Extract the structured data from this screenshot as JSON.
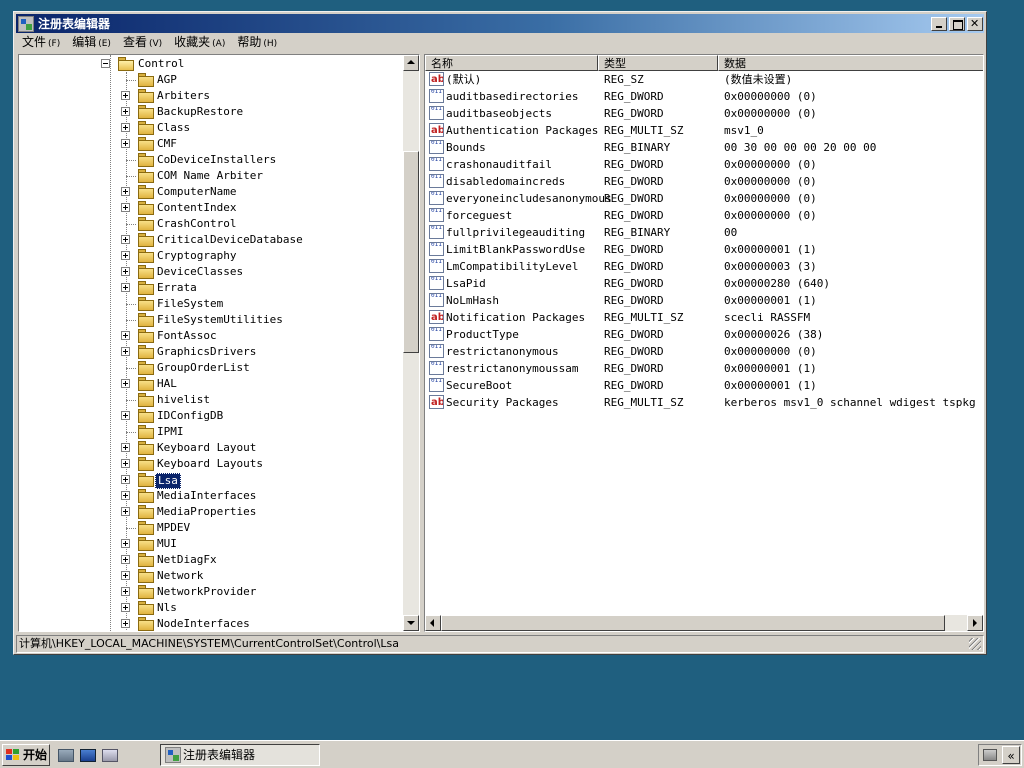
{
  "window": {
    "title": "注册表编辑器"
  },
  "menu": [
    {
      "label": "文件",
      "accel": "(F)"
    },
    {
      "label": "编辑",
      "accel": "(E)"
    },
    {
      "label": "查看",
      "accel": "(V)"
    },
    {
      "label": "收藏夹",
      "accel": "(A)"
    },
    {
      "label": "帮助",
      "accel": "(H)"
    }
  ],
  "tree": {
    "parent": "Control",
    "children": [
      {
        "label": "AGP",
        "expandable": false
      },
      {
        "label": "Arbiters",
        "expandable": true
      },
      {
        "label": "BackupRestore",
        "expandable": true
      },
      {
        "label": "Class",
        "expandable": true
      },
      {
        "label": "CMF",
        "expandable": true
      },
      {
        "label": "CoDeviceInstallers",
        "expandable": false
      },
      {
        "label": "COM Name Arbiter",
        "expandable": false
      },
      {
        "label": "ComputerName",
        "expandable": true
      },
      {
        "label": "ContentIndex",
        "expandable": true
      },
      {
        "label": "CrashControl",
        "expandable": false
      },
      {
        "label": "CriticalDeviceDatabase",
        "expandable": true
      },
      {
        "label": "Cryptography",
        "expandable": true
      },
      {
        "label": "DeviceClasses",
        "expandable": true
      },
      {
        "label": "Errata",
        "expandable": true
      },
      {
        "label": "FileSystem",
        "expandable": false
      },
      {
        "label": "FileSystemUtilities",
        "expandable": false
      },
      {
        "label": "FontAssoc",
        "expandable": true
      },
      {
        "label": "GraphicsDrivers",
        "expandable": true
      },
      {
        "label": "GroupOrderList",
        "expandable": false
      },
      {
        "label": "HAL",
        "expandable": true
      },
      {
        "label": "hivelist",
        "expandable": false
      },
      {
        "label": "IDConfigDB",
        "expandable": true
      },
      {
        "label": "IPMI",
        "expandable": false
      },
      {
        "label": "Keyboard Layout",
        "expandable": true
      },
      {
        "label": "Keyboard Layouts",
        "expandable": true
      },
      {
        "label": "Lsa",
        "expandable": true,
        "selected": true
      },
      {
        "label": "MediaInterfaces",
        "expandable": true
      },
      {
        "label": "MediaProperties",
        "expandable": true
      },
      {
        "label": "MPDEV",
        "expandable": false
      },
      {
        "label": "MUI",
        "expandable": true
      },
      {
        "label": "NetDiagFx",
        "expandable": true
      },
      {
        "label": "Network",
        "expandable": true
      },
      {
        "label": "NetworkProvider",
        "expandable": true
      },
      {
        "label": "Nls",
        "expandable": true
      },
      {
        "label": "NodeInterfaces",
        "expandable": true
      }
    ]
  },
  "columns": {
    "name": "名称",
    "type": "类型",
    "data": "数据"
  },
  "values": [
    {
      "icon": "string-value-icon",
      "kind": "str",
      "name": "(默认)",
      "type": "REG_SZ",
      "data": "(数值未设置)"
    },
    {
      "icon": "binary-value-icon",
      "kind": "bin",
      "name": "auditbasedirectories",
      "type": "REG_DWORD",
      "data": "0x00000000 (0)"
    },
    {
      "icon": "binary-value-icon",
      "kind": "bin",
      "name": "auditbaseobjects",
      "type": "REG_DWORD",
      "data": "0x00000000 (0)"
    },
    {
      "icon": "string-value-icon",
      "kind": "str",
      "name": "Authentication Packages",
      "type": "REG_MULTI_SZ",
      "data": "msv1_0"
    },
    {
      "icon": "binary-value-icon",
      "kind": "bin",
      "name": "Bounds",
      "type": "REG_BINARY",
      "data": "00 30 00 00 00 20 00 00"
    },
    {
      "icon": "binary-value-icon",
      "kind": "bin",
      "name": "crashonauditfail",
      "type": "REG_DWORD",
      "data": "0x00000000 (0)"
    },
    {
      "icon": "binary-value-icon",
      "kind": "bin",
      "name": "disabledomaincreds",
      "type": "REG_DWORD",
      "data": "0x00000000 (0)"
    },
    {
      "icon": "binary-value-icon",
      "kind": "bin",
      "name": "everyoneincludesanonymous",
      "type": "REG_DWORD",
      "data": "0x00000000 (0)"
    },
    {
      "icon": "binary-value-icon",
      "kind": "bin",
      "name": "forceguest",
      "type": "REG_DWORD",
      "data": "0x00000000 (0)"
    },
    {
      "icon": "binary-value-icon",
      "kind": "bin",
      "name": "fullprivilegeauditing",
      "type": "REG_BINARY",
      "data": "00"
    },
    {
      "icon": "binary-value-icon",
      "kind": "bin",
      "name": "LimitBlankPasswordUse",
      "type": "REG_DWORD",
      "data": "0x00000001 (1)"
    },
    {
      "icon": "binary-value-icon",
      "kind": "bin",
      "name": "LmCompatibilityLevel",
      "type": "REG_DWORD",
      "data": "0x00000003 (3)"
    },
    {
      "icon": "binary-value-icon",
      "kind": "bin",
      "name": "LsaPid",
      "type": "REG_DWORD",
      "data": "0x00000280 (640)"
    },
    {
      "icon": "binary-value-icon",
      "kind": "bin",
      "name": "NoLmHash",
      "type": "REG_DWORD",
      "data": "0x00000001 (1)"
    },
    {
      "icon": "string-value-icon",
      "kind": "str",
      "name": "Notification Packages",
      "type": "REG_MULTI_SZ",
      "data": "scecli RASSFM"
    },
    {
      "icon": "binary-value-icon",
      "kind": "bin",
      "name": "ProductType",
      "type": "REG_DWORD",
      "data": "0x00000026 (38)"
    },
    {
      "icon": "binary-value-icon",
      "kind": "bin",
      "name": "restrictanonymous",
      "type": "REG_DWORD",
      "data": "0x00000000 (0)"
    },
    {
      "icon": "binary-value-icon",
      "kind": "bin",
      "name": "restrictanonymoussam",
      "type": "REG_DWORD",
      "data": "0x00000001 (1)"
    },
    {
      "icon": "binary-value-icon",
      "kind": "bin",
      "name": "SecureBoot",
      "type": "REG_DWORD",
      "data": "0x00000001 (1)"
    },
    {
      "icon": "string-value-icon",
      "kind": "str",
      "name": "Security Packages",
      "type": "REG_MULTI_SZ",
      "data": "kerberos msv1_0 schannel wdigest tspkg"
    }
  ],
  "statusbar": {
    "path": "计算机\\HKEY_LOCAL_MACHINE\\SYSTEM\\CurrentControlSet\\Control\\Lsa"
  },
  "taskbar": {
    "start_label": "开始",
    "task_label": "注册表编辑器",
    "tray_chevron": "«"
  },
  "colors": {
    "desktop": "#1f5f7f",
    "titlebar_start": "#0a246a",
    "selection": "#0a246a"
  }
}
